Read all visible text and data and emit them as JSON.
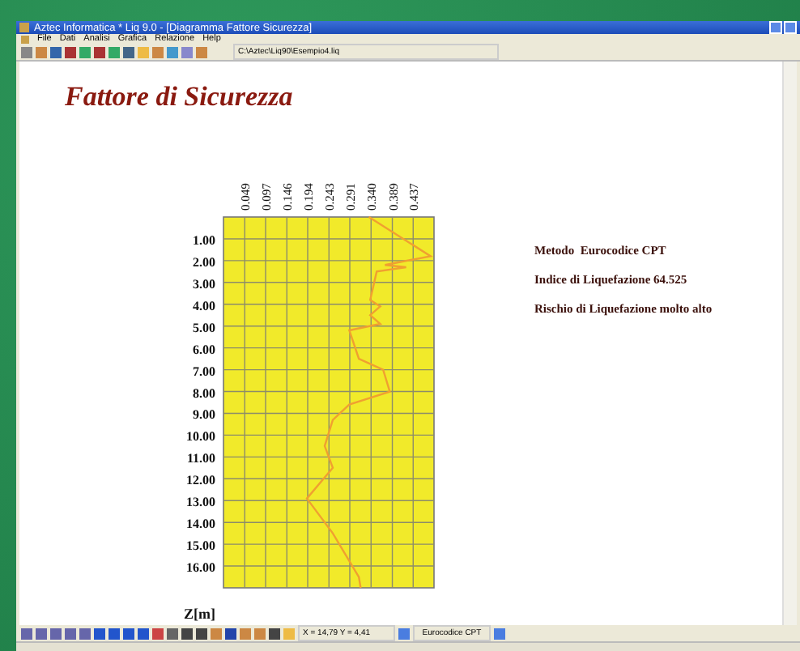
{
  "window": {
    "title": "Aztec Informatica * Liq 9.0 - [Diagramma Fattore Sicurezza]"
  },
  "menu": [
    "File",
    "Dati",
    "Analisi",
    "Grafica",
    "Relazione",
    "Help"
  ],
  "toolbar": {
    "path": "C:\\Aztec\\Liq90\\Esempio4.liq"
  },
  "page_title": "Fattore di Sicurezza",
  "chart_data": {
    "type": "line",
    "grid": true,
    "orientation": "horizontal",
    "ylabel": "Z[m]",
    "xlim": [
      0,
      0.485
    ],
    "ylim": [
      17,
      0
    ],
    "x": [
      0,
      1.8,
      2.2,
      2.3,
      2.5,
      3.8,
      4.1,
      4.5,
      4.9,
      5.2,
      6.5,
      7,
      8,
      8.6,
      9.3,
      10.5,
      11.5,
      12.9,
      14.5,
      16.5,
      17
    ],
    "series": [
      {
        "color": "#f0a030",
        "values": [
          0.335,
          0.477,
          0.372,
          0.421,
          0.353,
          0.338,
          0.361,
          0.338,
          0.361,
          0.29,
          0.312,
          0.368,
          0.383,
          0.29,
          0.252,
          0.233,
          0.252,
          0.192,
          0.252,
          0.312,
          0.316
        ]
      }
    ],
    "xticks": [
      0.049,
      0.097,
      0.146,
      0.194,
      0.243,
      0.291,
      {
        "value": 0.34,
        "label": "0.340"
      },
      0.389,
      0.437
    ],
    "yticks": [
      {
        "value": 1,
        "label": "1.00"
      },
      {
        "value": 2,
        "label": "2.00"
      },
      {
        "value": 3,
        "label": "3.00"
      },
      {
        "value": 4,
        "label": "4.00"
      },
      {
        "value": 5,
        "label": "5.00"
      },
      {
        "value": 6,
        "label": "6.00"
      },
      {
        "value": 7,
        "label": "7.00"
      },
      {
        "value": 8,
        "label": "8.00"
      },
      {
        "value": 9,
        "label": "9.00"
      },
      {
        "value": 10,
        "label": "10.00"
      },
      {
        "value": 11,
        "label": "11.00"
      },
      {
        "value": 12,
        "label": "12.00"
      },
      {
        "value": 13,
        "label": "13.00"
      },
      {
        "value": 14,
        "label": "14.00"
      },
      {
        "value": 15,
        "label": "15.00"
      },
      {
        "value": 16,
        "label": "16.00"
      }
    ]
  },
  "info": [
    "Metodo  Eurocodice CPT",
    "Indice di Liquefazione 64.525",
    "Rischio di Liquefazione molto alto"
  ],
  "bottom_toolbar": {
    "coordinates": "X = 14,79  Y = 4,41",
    "method": "Eurocodice CPT"
  }
}
